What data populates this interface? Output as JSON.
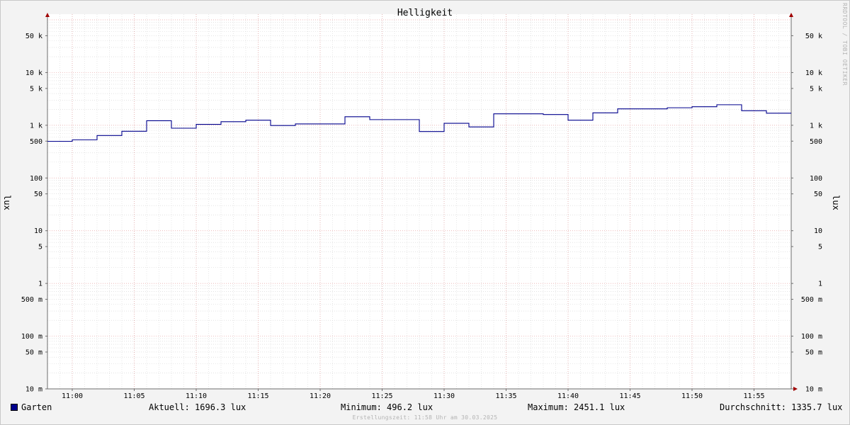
{
  "chart_data": {
    "type": "line",
    "title": "Helligkeit",
    "ylabel": "lux",
    "ylabel_right": "lux",
    "watermark": "RRDTOOL / TOBI OETIKER",
    "yscale": "log",
    "ylim": [
      0.01,
      100000
    ],
    "yticks": [
      {
        "value": 50000,
        "label": "50 k"
      },
      {
        "value": 10000,
        "label": "10 k"
      },
      {
        "value": 5000,
        "label": "5 k"
      },
      {
        "value": 1000,
        "label": "1 k"
      },
      {
        "value": 500,
        "label": "500"
      },
      {
        "value": 100,
        "label": "100"
      },
      {
        "value": 50,
        "label": "50"
      },
      {
        "value": 10,
        "label": "10"
      },
      {
        "value": 5,
        "label": "5"
      },
      {
        "value": 1,
        "label": "1"
      },
      {
        "value": 0.5,
        "label": "500 m"
      },
      {
        "value": 0.1,
        "label": "100 m"
      },
      {
        "value": 0.05,
        "label": "50 m"
      },
      {
        "value": 0.01,
        "label": "10 m"
      }
    ],
    "xlim": [
      "10:58",
      "11:58"
    ],
    "xticks": [
      "11:00",
      "11:05",
      "11:10",
      "11:15",
      "11:20",
      "11:25",
      "11:30",
      "11:35",
      "11:40",
      "11:45",
      "11:50",
      "11:55"
    ],
    "grid": true,
    "series": [
      {
        "name": "Garten",
        "color": "#00008c",
        "step": true,
        "x": [
          "10:58",
          "11:00",
          "11:02",
          "11:04",
          "11:06",
          "11:08",
          "11:10",
          "11:12",
          "11:14",
          "11:16",
          "11:18",
          "11:22",
          "11:24",
          "11:28",
          "11:30",
          "11:32",
          "11:34",
          "11:38",
          "11:40",
          "11:42",
          "11:44",
          "11:48",
          "11:50",
          "11:52",
          "11:54",
          "11:56",
          "11:58"
        ],
        "values": [
          496.2,
          530,
          640,
          770,
          1220,
          880,
          1040,
          1170,
          1250,
          990,
          1060,
          1450,
          1280,
          760,
          1090,
          930,
          1650,
          1600,
          1250,
          1720,
          2050,
          2150,
          2250,
          2451.1,
          1890,
          1696.3,
          1696.3
        ]
      }
    ],
    "legend": {
      "name": "Garten",
      "current": "Aktuell: 1696.3 lux",
      "minimum": "Minimum: 496.2 lux",
      "maximum": "Maximum: 2451.1 lux",
      "average": "Durchschnitt: 1335.7 lux"
    },
    "footer": "Erstellungszeit: 11:58 Uhr am 30.03.2025"
  }
}
